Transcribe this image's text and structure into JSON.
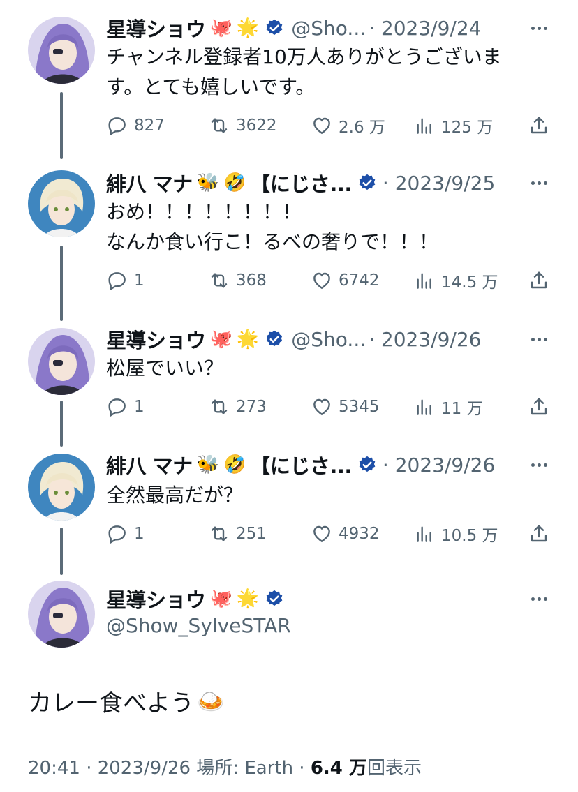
{
  "colors": {
    "text": "#0f1419",
    "secondary": "#536471",
    "verified": "#1d9bf0",
    "thread_line": "#5b6b78"
  },
  "tweets": [
    {
      "name": "星導ショウ",
      "emojis": [
        "🐙",
        "🌟"
      ],
      "handle": "@Sho...",
      "date": "· 2023/9/24",
      "text": "チャンネル登録者10万人ありがとうございま\nす。とても嬉しいです。",
      "replies": "827",
      "retweets": "3622",
      "likes": "2.6 万",
      "views": "125 万"
    },
    {
      "name": "緋八 マナ",
      "emojis": [
        "🐝",
        "🤣"
      ],
      "handle": "【にじさ...",
      "date": "· 2023/9/25",
      "text": "おめ！！！！！！！！\nなんか食い行こ！るべの奢りで！！！",
      "replies": "1",
      "retweets": "368",
      "likes": "6742",
      "views": "14.5 万"
    },
    {
      "name": "星導ショウ",
      "emojis": [
        "🐙",
        "🌟"
      ],
      "handle": "@Sho...",
      "date": "· 2023/9/26",
      "text": "松屋でいい？",
      "replies": "1",
      "retweets": "273",
      "likes": "5345",
      "views": "11 万"
    },
    {
      "name": "緋八 マナ",
      "emojis": [
        "🐝",
        "🤣"
      ],
      "handle": "【にじさ...",
      "date": "· 2023/9/26",
      "text": "全然最高だが？",
      "replies": "1",
      "retweets": "251",
      "likes": "4932",
      "views": "10.5 万"
    }
  ],
  "main": {
    "name": "星導ショウ",
    "emojis": [
      "🐙",
      "🌟"
    ],
    "handle": "@Show_SylveSTAR",
    "text": "カレー食べよう",
    "text_emoji": "🍛",
    "meta_prefix": "20:41 · 2023/9/26 場所: Earth · ",
    "views_count": "6.4 万",
    "views_label": "回表示"
  }
}
